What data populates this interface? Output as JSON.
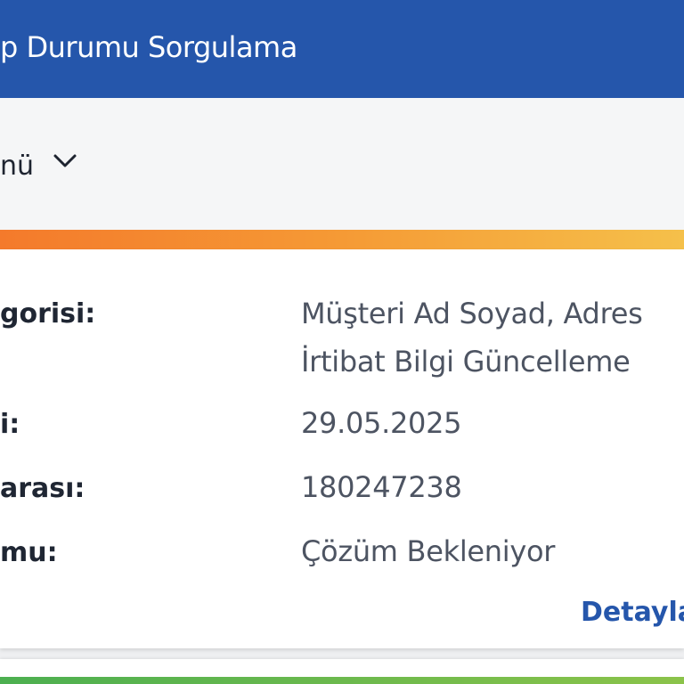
{
  "header": {
    "title": "p Durumu Sorgulama"
  },
  "menu": {
    "label": "nü",
    "icon": "chevron-down-icon"
  },
  "record": {
    "rows": [
      {
        "label": "gorisi:",
        "value_line1": "Müşteri Ad Soyad, Adres",
        "value_line2": "İrtibat Bilgi Güncelleme"
      },
      {
        "label": "i:",
        "value": "29.05.2025"
      },
      {
        "label": "arası:",
        "value": "180247238"
      },
      {
        "label": "mu:",
        "value": "Çözüm Bekleniyor"
      }
    ],
    "detail_link": "Detayla"
  },
  "colors": {
    "header_bg": "#2556ab",
    "accent_start": "#f47a2b",
    "accent_end": "#f5c04a",
    "link": "#2556ab",
    "next_accent": "#4caf50"
  }
}
